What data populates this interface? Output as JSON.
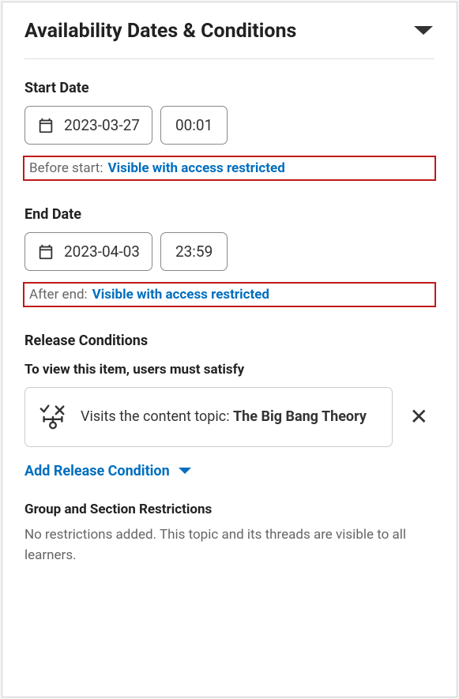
{
  "header": {
    "title": "Availability Dates & Conditions"
  },
  "start": {
    "label": "Start Date",
    "date": "2023-03-27",
    "time": "00:01",
    "status_prefix": "Before start:",
    "status_link": "Visible with access restricted"
  },
  "end": {
    "label": "End Date",
    "date": "2023-04-03",
    "time": "23:59",
    "status_prefix": "After end:",
    "status_link": "Visible with access restricted"
  },
  "release": {
    "section_label": "Release Conditions",
    "must_satisfy": "To view this item, users must satisfy",
    "condition_prefix": "Visits the content topic: ",
    "condition_topic": "The Big Bang Theory",
    "add_link": "Add Release Condition"
  },
  "group": {
    "label": "Group and Section Restrictions",
    "text": "No restrictions added. This topic and its threads are visible to all learners."
  }
}
